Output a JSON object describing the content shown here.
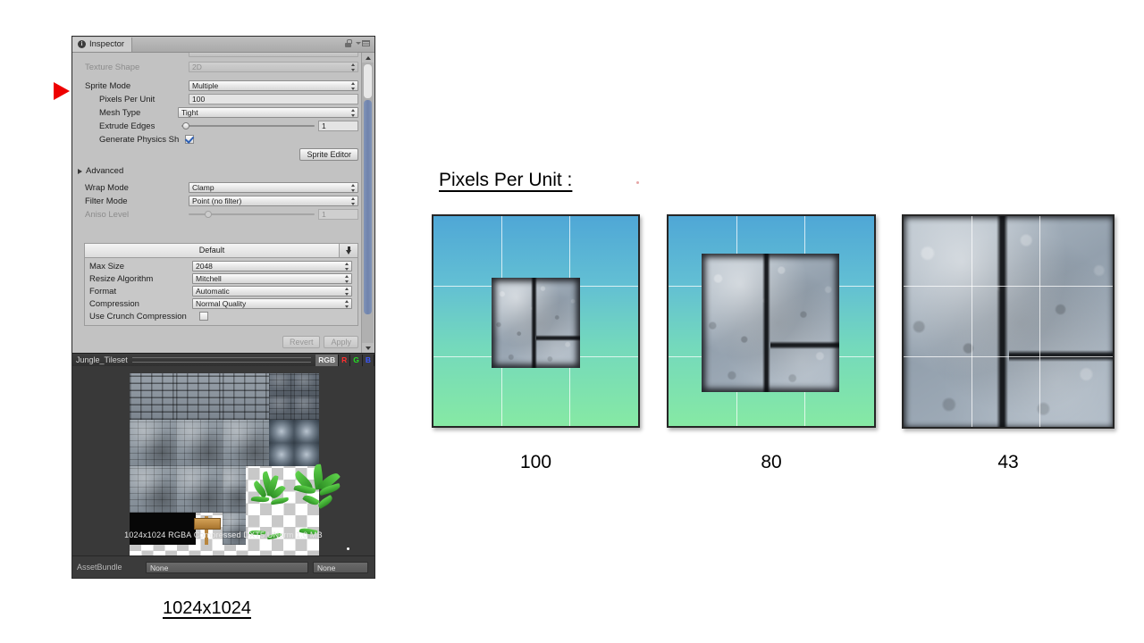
{
  "inspector": {
    "tab_label": "Inspector",
    "icons": {
      "info": "i",
      "lock": "lock-icon",
      "menu": "menu-icon"
    },
    "fields": [
      {
        "label": "Texture Shape",
        "value": "2D",
        "type": "popup",
        "disabled": true
      },
      {
        "label": "Sprite Mode",
        "value": "Multiple",
        "type": "popup",
        "disabled": false
      },
      {
        "label": "Pixels Per Unit",
        "value": "100",
        "type": "text",
        "disabled": false
      },
      {
        "label": "Mesh Type",
        "value": "Tight",
        "type": "popup",
        "disabled": false
      },
      {
        "label": "Extrude Edges",
        "value": "1",
        "type": "slider",
        "disabled": false
      },
      {
        "label": "Generate Physics Sh",
        "value": "",
        "type": "checkbox",
        "checked": true
      }
    ],
    "sprite_editor_button": "Sprite Editor",
    "advanced_foldout": "Advanced",
    "fields2": [
      {
        "label": "Wrap Mode",
        "value": "Clamp",
        "type": "popup",
        "disabled": false
      },
      {
        "label": "Filter Mode",
        "value": "Point (no filter)",
        "type": "popup",
        "disabled": false
      },
      {
        "label": "Aniso Level",
        "value": "1",
        "type": "slider",
        "disabled": true
      }
    ],
    "platform": {
      "tab_label": "Default",
      "rows": [
        {
          "label": "Max Size",
          "value": "2048",
          "type": "popup"
        },
        {
          "label": "Resize Algorithm",
          "value": "Mitchell",
          "type": "popup"
        },
        {
          "label": "Format",
          "value": "Automatic",
          "type": "popup"
        },
        {
          "label": "Compression",
          "value": "Normal Quality",
          "type": "popup"
        },
        {
          "label": "Use Crunch Compression",
          "value": "",
          "type": "checkbox",
          "checked": false
        }
      ]
    },
    "revert_label": "Revert",
    "apply_label": "Apply",
    "preview": {
      "title": "Jungle_Tileset",
      "channels": [
        "RGB",
        "R",
        "G",
        "B"
      ],
      "info": "1024x1024  RGBA Compressed DXT5 UNorm   1.0 MB"
    },
    "assetbundle": {
      "label": "AssetBundle",
      "name_value": "None",
      "variant_value": "None"
    }
  },
  "annotations": {
    "texture_size_caption": "1024x1024",
    "heading": "Pixels Per Unit :",
    "arrow": "red-arrow-icon"
  },
  "scenes": [
    {
      "label": "100",
      "sprite_scale": 0.415
    },
    {
      "label": "80",
      "sprite_scale": 0.66
    },
    {
      "label": "43",
      "sprite_scale": 1.0
    }
  ],
  "colors": {
    "sky_top": "#4fa7d6",
    "ground_bottom": "#86e9a4",
    "arrow_red": "#ee0000",
    "inspector_bg": "#c2c2c2",
    "preview_bg": "#393939"
  }
}
